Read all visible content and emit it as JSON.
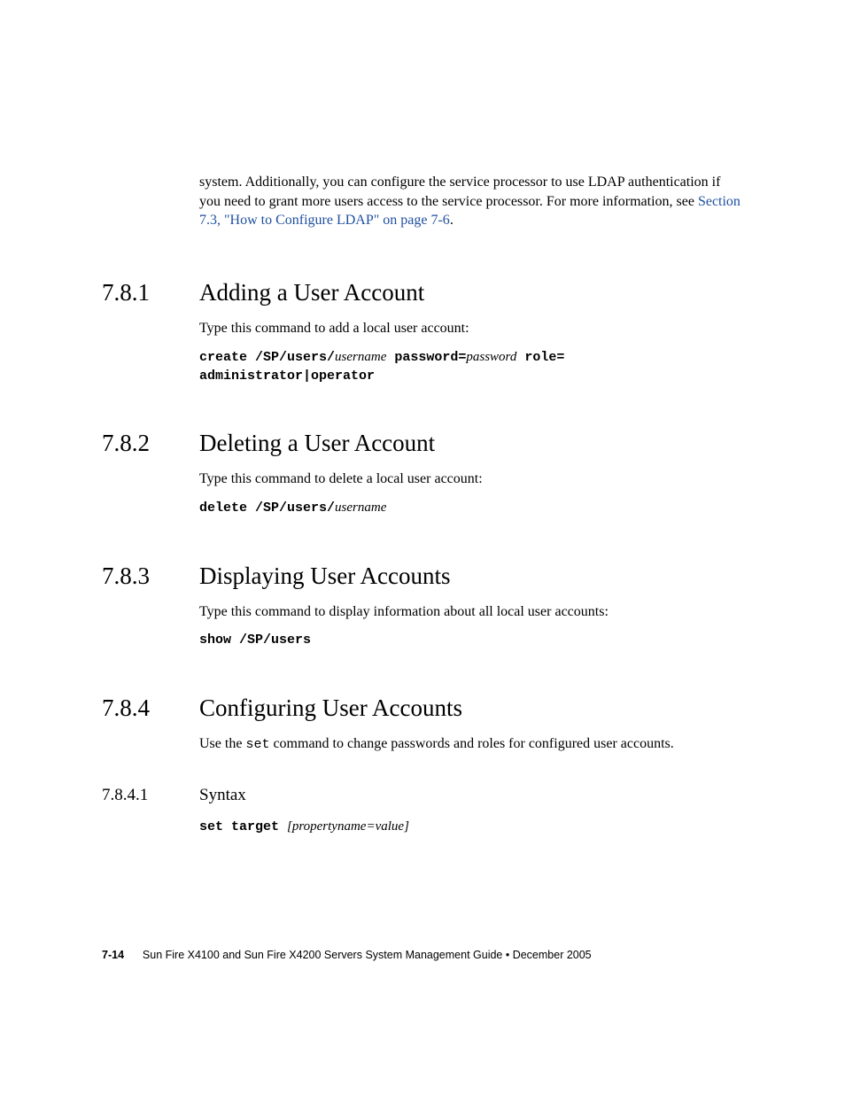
{
  "intro": {
    "text_before_link": "system. Additionally, you can configure the service processor to use LDAP authentication if you need to grant more users access to the service processor. For more information, see ",
    "link_text": "Section 7.3, \"How to Configure LDAP\" on page 7-6",
    "text_after_link": "."
  },
  "sections": {
    "s781": {
      "number": "7.8.1",
      "title": "Adding a User Account",
      "body": "Type this command to add a local user account:",
      "code_parts": {
        "p1": "create /SP/users/",
        "p2": "username",
        "p3": " password=",
        "p4": "password",
        "p5": "  role=",
        "line2": "administrator|operator"
      }
    },
    "s782": {
      "number": "7.8.2",
      "title": "Deleting a User Account",
      "body": "Type this command to delete a local user account:",
      "code_parts": {
        "p1": "delete /SP/users/",
        "p2": "username"
      }
    },
    "s783": {
      "number": "7.8.3",
      "title": "Displaying User Accounts",
      "body": "Type this command to display information about all local user accounts:",
      "code": "show /SP/users"
    },
    "s784": {
      "number": "7.8.4",
      "title": "Configuring User Accounts",
      "body_before": "Use the ",
      "body_mono": "set",
      "body_after": " command to change passwords and roles for configured user accounts.",
      "sub": {
        "number": "7.8.4.1",
        "title": "Syntax",
        "code_parts": {
          "p1": "set target ",
          "p2": "[propertyname=value]"
        }
      }
    }
  },
  "footer": {
    "page": "7-14",
    "text": "Sun Fire X4100 and Sun Fire X4200 Servers System Management Guide  •  December 2005"
  }
}
